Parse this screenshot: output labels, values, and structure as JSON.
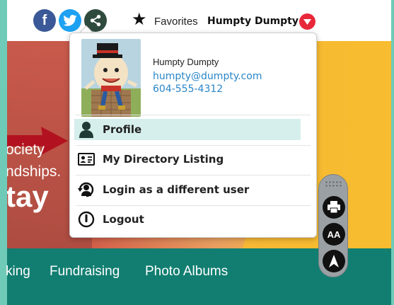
{
  "topbar": {
    "social": [
      {
        "name": "facebook",
        "glyph": "f"
      },
      {
        "name": "twitter",
        "glyph": ""
      },
      {
        "name": "share",
        "glyph": ""
      }
    ],
    "favorites_label": "Favorites",
    "user_name": "Humpty Dumpty"
  },
  "hero": {
    "line1": "ociety",
    "line2": "ndships.",
    "line3": "tay"
  },
  "nav": {
    "items": [
      "king",
      "Fundraising",
      "Photo Albums"
    ]
  },
  "dropdown": {
    "name": "Humpty Dumpty",
    "email": "humpty@dumpty.com",
    "phone": "604-555-4312",
    "items": [
      {
        "label": "Profile",
        "icon": "person-icon",
        "active": true
      },
      {
        "label": "My Directory Listing",
        "icon": "id-card-icon",
        "active": false
      },
      {
        "label": "Login as a different user",
        "icon": "switch-user-icon",
        "active": false
      },
      {
        "label": "Logout",
        "icon": "power-icon",
        "active": false
      }
    ]
  },
  "accessibility": {
    "buttons": [
      "print-icon",
      "text-size-icon",
      "navigate-up-icon"
    ],
    "text_size_label": "AA"
  },
  "colors": {
    "accent_teal": "#117e71",
    "frame": "#6fcab8",
    "link_blue": "#2a86c8",
    "user_caret": "#e8283a",
    "active_row": "#d6efec"
  }
}
